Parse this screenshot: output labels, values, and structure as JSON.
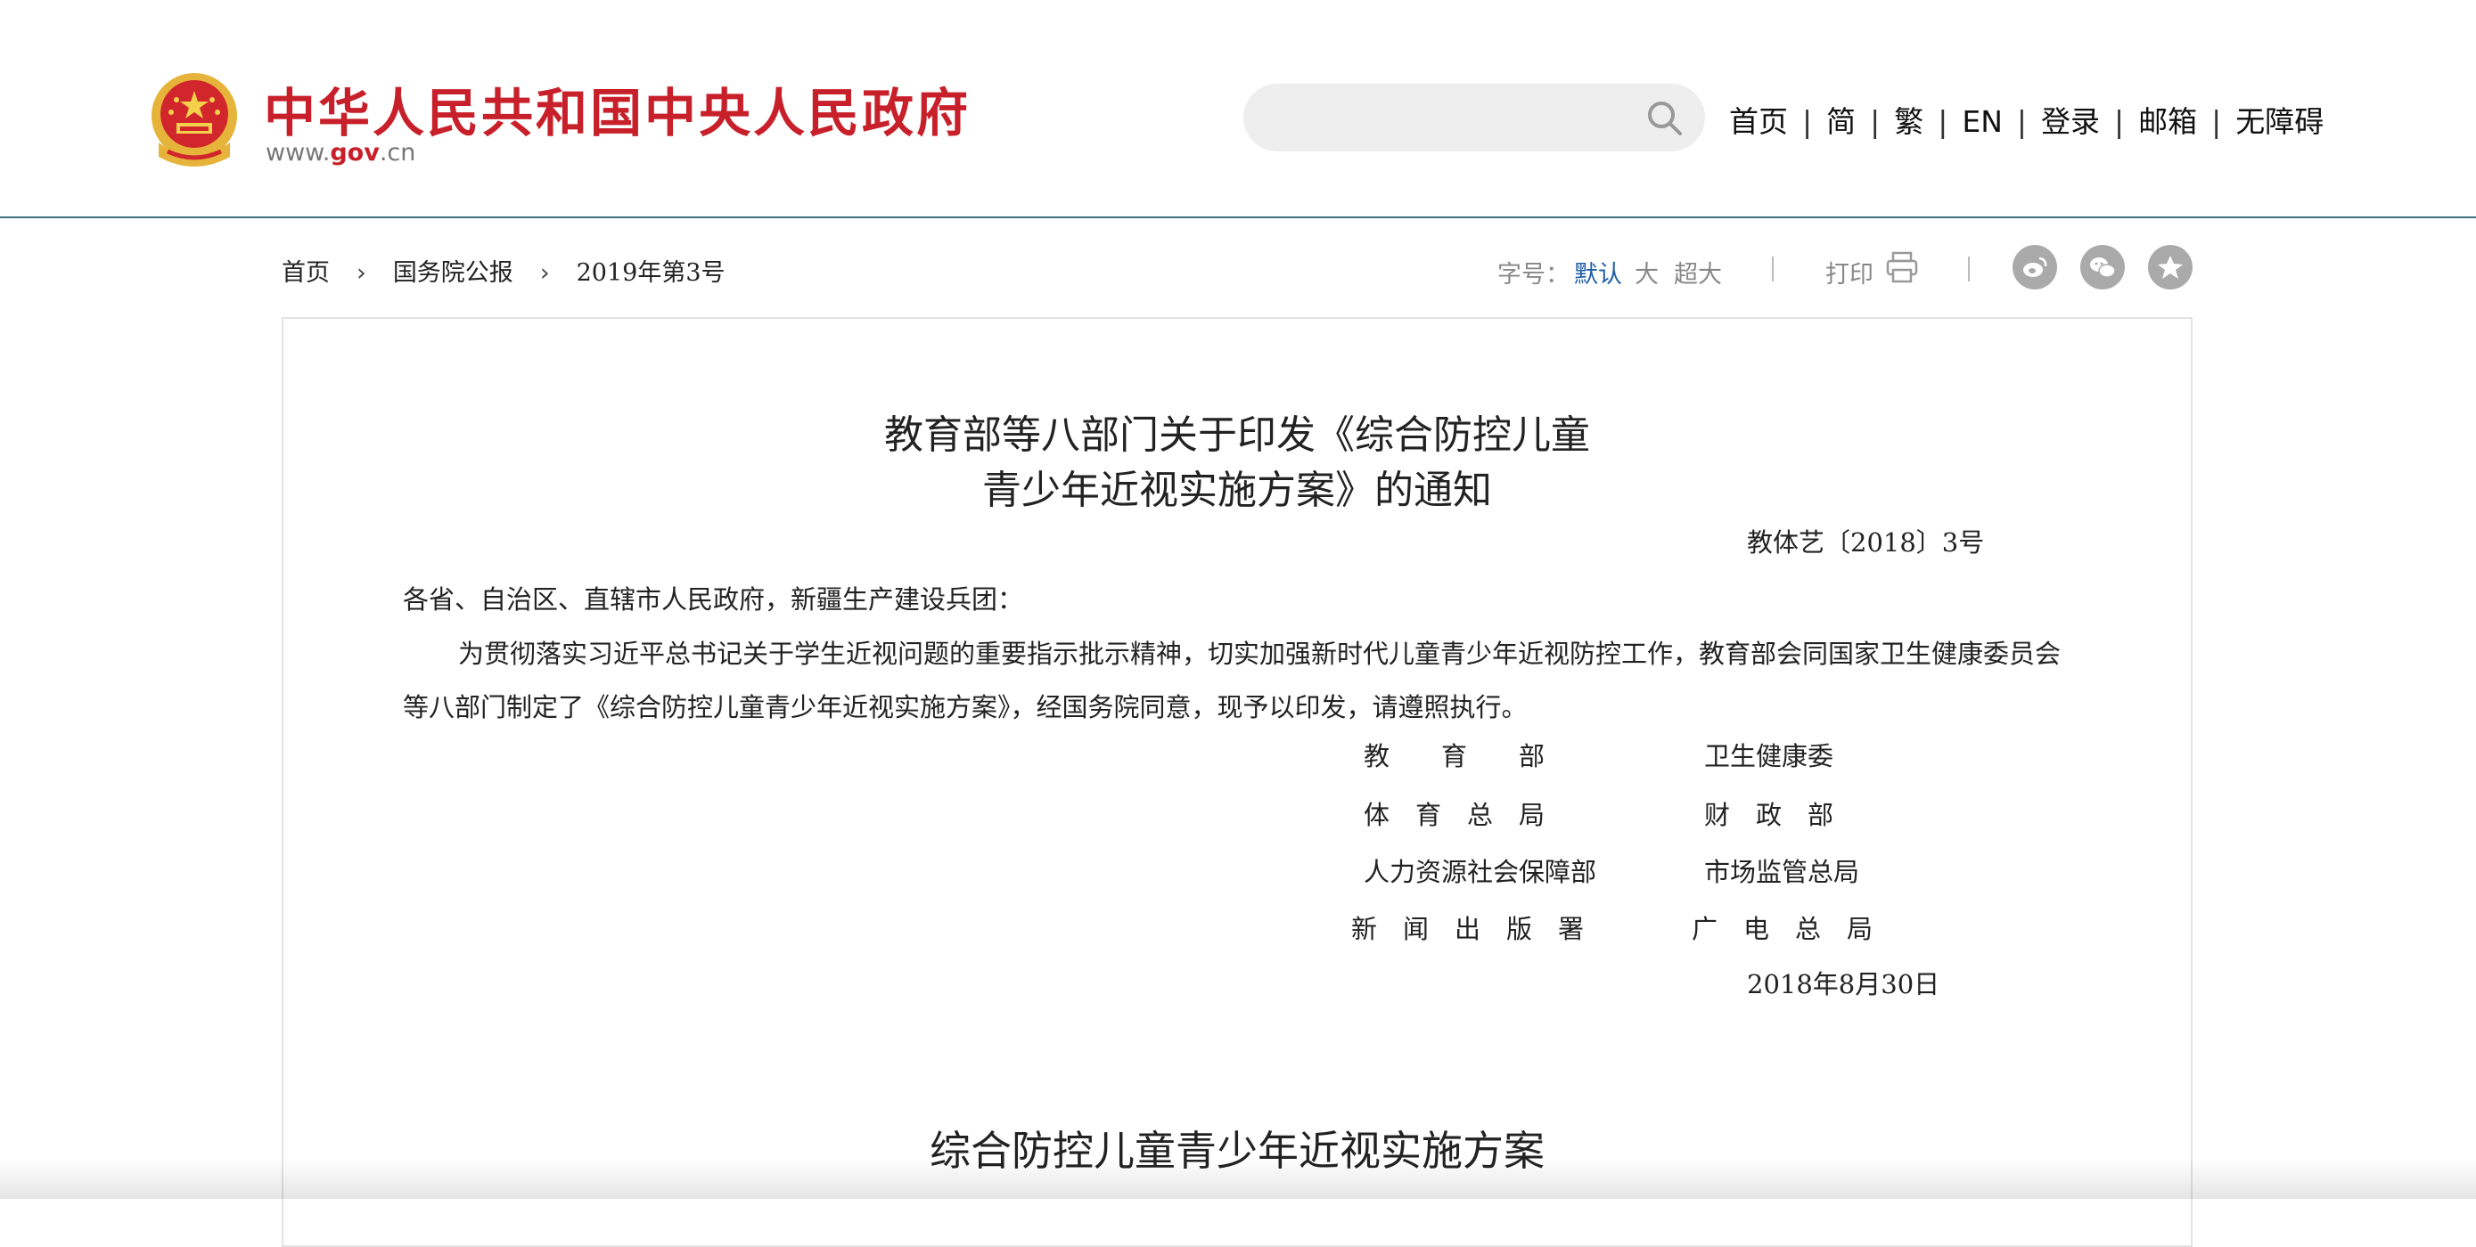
{
  "header": {
    "site_title": "中华人民共和国中央人民政府",
    "site_url_prefix": "www.",
    "site_url_domain": "gov",
    "site_url_suffix": ".cn",
    "search": {
      "placeholder": "",
      "icon": "search-icon"
    },
    "nav": [
      "首页",
      "简",
      "繁",
      "EN",
      "登录",
      "邮箱",
      "无障碍"
    ]
  },
  "breadcrumb": [
    "首页",
    "国务院公报",
    "2019年第3号"
  ],
  "tools": {
    "font_label": "字号：",
    "font_options": [
      "默认",
      "大",
      "超大"
    ],
    "print_label": "打印",
    "share_icons": [
      "weibo-icon",
      "wechat-icon",
      "favorite-star-icon"
    ]
  },
  "article": {
    "title_line1": "教育部等八部门关于印发《综合防控儿童",
    "title_line2": "青少年近视实施方案》的通知",
    "doc_number": "教体艺〔2018〕3号",
    "addressee": "各省、自治区、直辖市人民政府，新疆生产建设兵团：",
    "body": "为贯彻落实习近平总书记关于学生近视问题的重要指示批示精神，切实加强新时代儿童青少年近视防控工作，教育部会同国家卫生健康委员会等八部门制定了《综合防控儿童青少年近视实施方案》，经国务院同意，现予以印发，请遵照执行。",
    "signatories": [
      [
        "教　　育　　部",
        "卫生健康委"
      ],
      [
        "体　育　总　局",
        "财　政　部"
      ],
      [
        "人力资源社会保障部",
        "市场监管总局"
      ],
      [
        "新　闻　出　版　署",
        "广　电　总　局"
      ]
    ],
    "date": "2018年8月30日",
    "subtitle": "综合防控儿童青少年近视实施方案"
  },
  "colors": {
    "brand_red": "#c8202a",
    "header_rule": "#3d6f82",
    "active_blue": "#1f5fa8"
  }
}
